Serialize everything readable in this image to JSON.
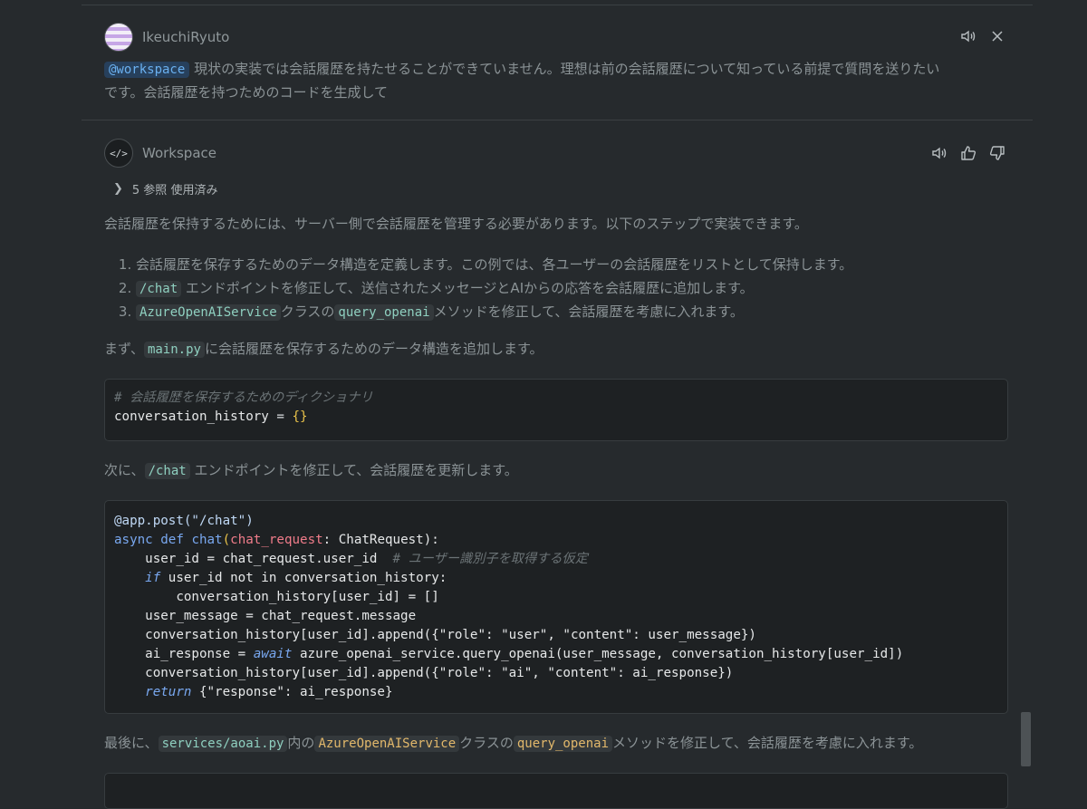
{
  "user_message": {
    "author": "IkeuchiRyuto",
    "mention": "@workspace",
    "text_line1": " 現状の実装では会話履歴を持たせることができていません。理想は前の会話履歴について知っている前提で質問を送りたい",
    "text_line2": "です。会話履歴を持つためのコードを生成して"
  },
  "assistant": {
    "author": "Workspace",
    "avatar_glyph": "</>",
    "references": "5 参照 使用済み",
    "intro": "会話履歴を保持するためには、サーバー側で会話履歴を管理する必要があります。以下のステップで実装できます。",
    "steps": [
      {
        "pre": "",
        "code": "",
        "text": "会話履歴を保存するためのデータ構造を定義します。この例では、各ユーザーの会話履歴をリストとして保持します。"
      },
      {
        "code": "/chat",
        "text": " エンドポイントを修正して、送信されたメッセージとAIからの応答を会話履歴に追加します。"
      },
      {
        "code": "AzureOpenAIService",
        "mid": "クラスの",
        "code2": "query_openai",
        "text": "メソッドを修正して、会話履歴を考慮に入れます。"
      }
    ],
    "para_mainpy": {
      "pre": "まず、",
      "code": "main.py",
      "post": "に会話履歴を保存するためのデータ構造を追加します。"
    },
    "code1": {
      "comment": "# 会話履歴を保存するためのディクショナリ",
      "l2_var": "conversation_history",
      "l2_op": " = ",
      "l2_val": "{}"
    },
    "para_chat": {
      "pre": "次に、",
      "code": "/chat",
      "post": " エンドポイントを修正して、会話履歴を更新します。"
    },
    "code2": {
      "l1": "@app.post(\"/chat\")",
      "l2_async": "async",
      "l2_def": "def",
      "l2_fn": "chat",
      "l2_param": "chat_request",
      "l2_rest": ": ChatRequest):",
      "l3": "    user_id = chat_request.user_id  ",
      "l3_cm": "# ユーザー識別子を取得する仮定",
      "l4_if": "if",
      "l4_rest": " user_id not in conversation_history:",
      "l5": "        conversation_history[user_id] = []",
      "l6": "    user_message = chat_request.message",
      "l7": "    conversation_history[user_id].append({\"role\": \"user\", \"content\": user_message})",
      "l8_pre": "    ai_response = ",
      "l8_await": "await",
      "l8_rest": " azure_openai_service.query_openai(user_message, conversation_history[user_id])",
      "l9": "    conversation_history[user_id].append({\"role\": \"ai\", \"content\": ai_response})",
      "l10_ret": "return",
      "l10_rest": " {\"response\": ai_response}"
    },
    "para_last": {
      "pre": "最後に、",
      "code": "services/aoai.py",
      "mid1": "内の",
      "code2": "AzureOpenAIService",
      "mid2": "クラスの",
      "code3": "query_openai",
      "post": "メソッドを修正して、会話履歴を考慮に入れます。"
    }
  },
  "icons": {
    "speaker": "speaker-icon",
    "close": "close-icon",
    "thumbs_up": "thumbs-up-icon",
    "thumbs_down": "thumbs-down-icon",
    "chevron": "chevron-right-icon"
  }
}
